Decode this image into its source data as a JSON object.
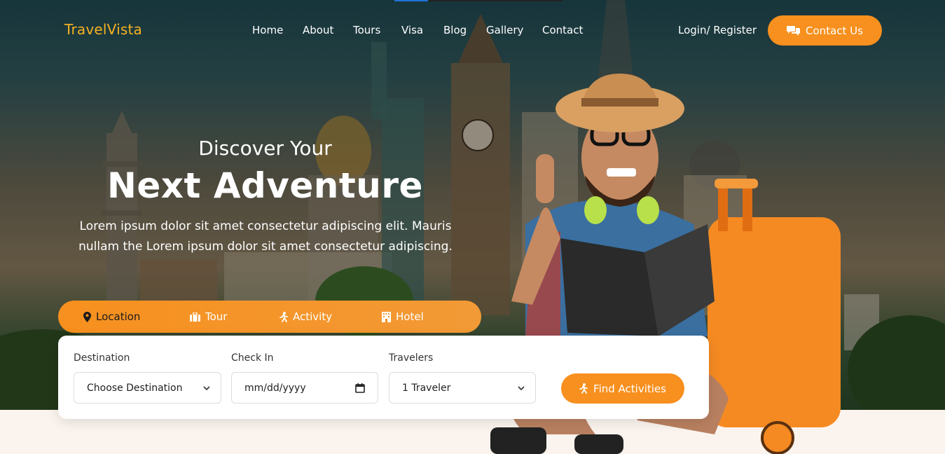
{
  "brand": {
    "name": "TravelVista"
  },
  "nav": {
    "items": [
      "Home",
      "About",
      "Tours",
      "Visa",
      "Blog",
      "Gallery",
      "Contact"
    ],
    "login_label": "Login/ Register",
    "contact_label": "Contact Us"
  },
  "hero": {
    "subtitle": "Discover Your",
    "title": "Next Adventure",
    "description_line1": "Lorem ipsum dolor sit amet consectetur adipiscing elit. Mauris",
    "description_line2": "nullam the Lorem ipsum dolor sit amet consectetur adipiscing."
  },
  "search": {
    "tabs": [
      {
        "label": "Location",
        "icon": "map-pin-icon",
        "active": true
      },
      {
        "label": "Tour",
        "icon": "briefcase-icon",
        "active": false
      },
      {
        "label": "Activity",
        "icon": "walking-icon",
        "active": false
      },
      {
        "label": "Hotel",
        "icon": "building-icon",
        "active": false
      }
    ],
    "destination_label": "Destination",
    "destination_value": "Choose Destination",
    "checkin_label": "Check In",
    "checkin_placeholder": "mm/dd/yyyy",
    "travelers_label": "Travelers",
    "travelers_value": "1 Traveler",
    "submit_label": "Find Activities"
  },
  "colors": {
    "accent": "#f7901e",
    "logo": "#f6b221",
    "page_bottom": "#fbf4ee"
  }
}
